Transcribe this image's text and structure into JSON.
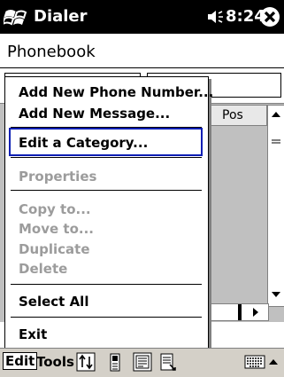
{
  "titlebar": {
    "app_title": "Dialer",
    "time": "8:24",
    "start_icon": "windows-flag-icon",
    "speaker_icon": "speaker-icon",
    "close_icon": "close-icon"
  },
  "page": {
    "title": "Phonebook"
  },
  "list": {
    "columns": [
      "Pos"
    ]
  },
  "menu": {
    "items": [
      {
        "label": "Add New Phone Number...",
        "enabled": true
      },
      {
        "label": "Add New Message...",
        "enabled": true
      },
      {
        "label": "Edit a Category...",
        "enabled": true,
        "selected": true
      },
      {
        "label": "Properties",
        "enabled": false
      },
      {
        "label": "Copy to...",
        "enabled": false
      },
      {
        "label": "Move to...",
        "enabled": false
      },
      {
        "label": "Duplicate",
        "enabled": false
      },
      {
        "label": "Delete",
        "enabled": false
      },
      {
        "label": "Select All",
        "enabled": true
      },
      {
        "label": "Exit",
        "enabled": true
      }
    ]
  },
  "commandbar": {
    "edit_label": "Edit",
    "tools_label": "Tools",
    "icons": [
      "sort-icon",
      "phone-icon",
      "card-view-icon",
      "dial-icon",
      "keyboard-icon"
    ]
  },
  "colors": {
    "titlebar": "#000000",
    "selection_border": "#0a1eb4",
    "disabled_text": "#9c9c9c",
    "list_background": "#c0c0c0"
  }
}
